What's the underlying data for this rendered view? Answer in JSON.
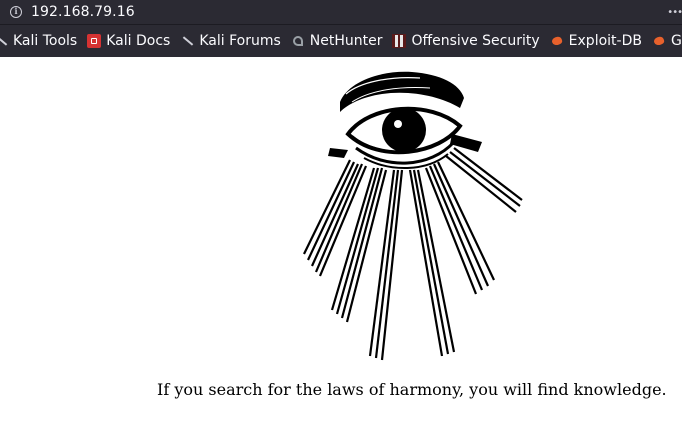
{
  "browser": {
    "url": "192.168.79.16",
    "bookmarks": [
      {
        "label": "Kali Tools",
        "icon": "kali-dragon-icon"
      },
      {
        "label": "Kali Docs",
        "icon": "kali-docs-icon"
      },
      {
        "label": "Kali Forums",
        "icon": "kali-dragon-icon"
      },
      {
        "label": "NetHunter",
        "icon": "nethunter-icon"
      },
      {
        "label": "Offensive Security",
        "icon": "offsec-icon"
      },
      {
        "label": "Exploit-DB",
        "icon": "exploit-db-icon"
      },
      {
        "label": "G",
        "icon": "exploit-db-icon"
      }
    ]
  },
  "page": {
    "image": "all-seeing-eye-with-rays",
    "caption": "If you search for the laws of harmony, you will find knowledge."
  }
}
